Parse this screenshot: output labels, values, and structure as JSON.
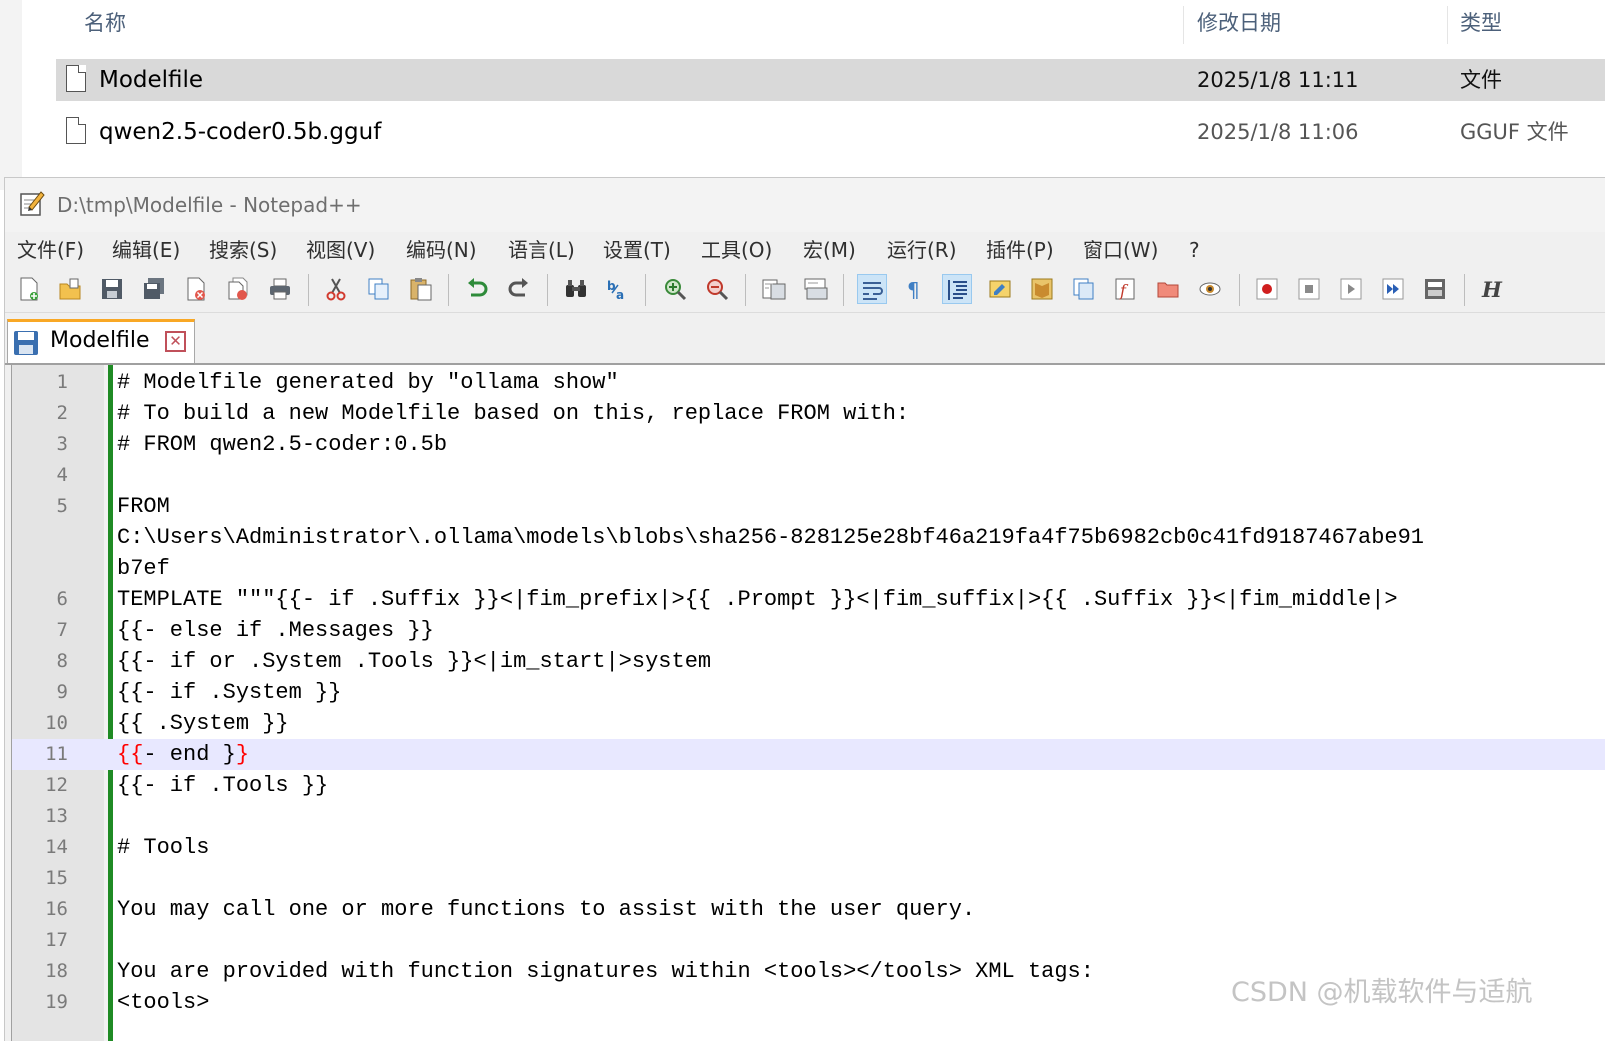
{
  "explorer": {
    "columns": {
      "name": "名称",
      "date": "修改日期",
      "type": "类型"
    },
    "files": [
      {
        "name": "Modelfile",
        "date": "2025/1/8 11:11",
        "type": "文件"
      },
      {
        "name": "qwen2.5-coder0.5b.gguf",
        "date": "2025/1/8 11:06",
        "type": "GGUF 文件"
      }
    ]
  },
  "notepad": {
    "title": "D:\\tmp\\Modelfile - Notepad++",
    "menu": [
      "文件(F)",
      "编辑(E)",
      "搜索(S)",
      "视图(V)",
      "编码(N)",
      "语言(L)",
      "设置(T)",
      "工具(O)",
      "宏(M)",
      "运行(R)",
      "插件(P)",
      "窗口(W)",
      "?"
    ],
    "toolbar_bold_label": "H",
    "tab": {
      "name": "Modelfile",
      "close_glyph": "✕"
    },
    "lines": [
      {
        "num": "1",
        "text": "# Modelfile generated by \"ollama show\""
      },
      {
        "num": "2",
        "text": "# To build a new Modelfile based on this, replace FROM with:"
      },
      {
        "num": "3",
        "text": "# FROM qwen2.5-coder:0.5b"
      },
      {
        "num": "4",
        "text": ""
      },
      {
        "num": "5",
        "text": "FROM"
      },
      {
        "num": "",
        "text": "C:\\Users\\Administrator\\.ollama\\models\\blobs\\sha256-828125e28bf46a219fa4f75b6982cb0c41fd9187467abe91"
      },
      {
        "num": "",
        "text": "b7ef"
      },
      {
        "num": "6",
        "text": "TEMPLATE \"\"\"{{- if .Suffix }}<|fim_prefix|>{{ .Prompt }}<|fim_suffix|>{{ .Suffix }}<|fim_middle|>"
      },
      {
        "num": "7",
        "text": "{{- else if .Messages }}"
      },
      {
        "num": "8",
        "text": "{{- if or .System .Tools }}<|im_start|>system"
      },
      {
        "num": "9",
        "text": "{{- if .System }}"
      },
      {
        "num": "10",
        "text": "{{ .System }}"
      },
      {
        "num": "11",
        "text": "- end }",
        "brace_open": "{{",
        "brace_close": "}"
      },
      {
        "num": "12",
        "text": "{{- if .Tools }}"
      },
      {
        "num": "13",
        "text": ""
      },
      {
        "num": "14",
        "text": "# Tools"
      },
      {
        "num": "15",
        "text": ""
      },
      {
        "num": "16",
        "text": "You may call one or more functions to assist with the user query."
      },
      {
        "num": "17",
        "text": ""
      },
      {
        "num": "18",
        "text": "You are provided with function signatures within <tools></tools> XML tags:"
      },
      {
        "num": "19",
        "text": "<tools>"
      }
    ]
  },
  "watermark": "CSDN @机载软件与适航",
  "colors": {
    "selected_row": "#d9d9d9",
    "change_bar": "#1f8b24",
    "current_line": "#e8e8ff",
    "brace_match": "#ff0000",
    "tab_accent": "#f9a825"
  }
}
